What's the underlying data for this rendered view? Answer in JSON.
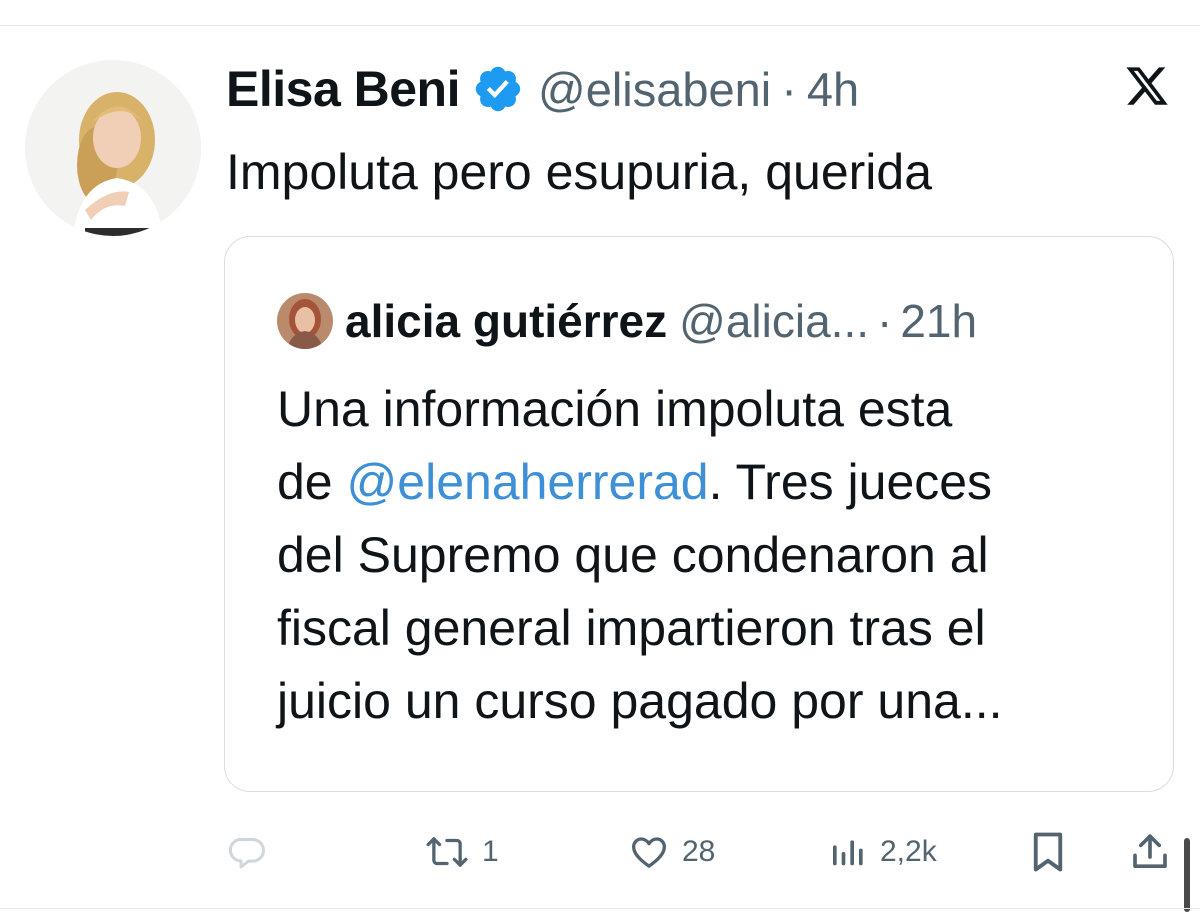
{
  "tweet": {
    "display_name": "Elisa Beni",
    "verified_icon": "verified-badge-icon",
    "handle": "@elisabeni",
    "separator": "·",
    "time": "4h",
    "text": "Impoluta pero esupuria, querida"
  },
  "quote": {
    "display_name": "alicia gutiérrez",
    "handle": "@alicia...",
    "separator": "·",
    "time": "21h",
    "lines": [
      {
        "text": "Una información impoluta esta"
      },
      {
        "prefix": "de ",
        "mention": "@elenaherrerad",
        "suffix": ". Tres jueces"
      },
      {
        "text": "del Supremo que condenaron al"
      },
      {
        "text": "fiscal general impartieron tras el"
      },
      {
        "text": "juicio un curso pagado por una..."
      }
    ]
  },
  "actions": {
    "reply": {
      "icon": "reply-icon"
    },
    "retweet": {
      "icon": "retweet-icon",
      "count": "1"
    },
    "like": {
      "icon": "heart-icon",
      "count": "28"
    },
    "views": {
      "icon": "views-icon",
      "count": "2,2k"
    },
    "bookmark": {
      "icon": "bookmark-icon"
    },
    "share": {
      "icon": "share-icon"
    }
  },
  "colors": {
    "text": "#0f1419",
    "secondary": "#536471",
    "mention": "#3d8fd6",
    "verified": "#1d9bf0",
    "border": "#d9dee2"
  }
}
